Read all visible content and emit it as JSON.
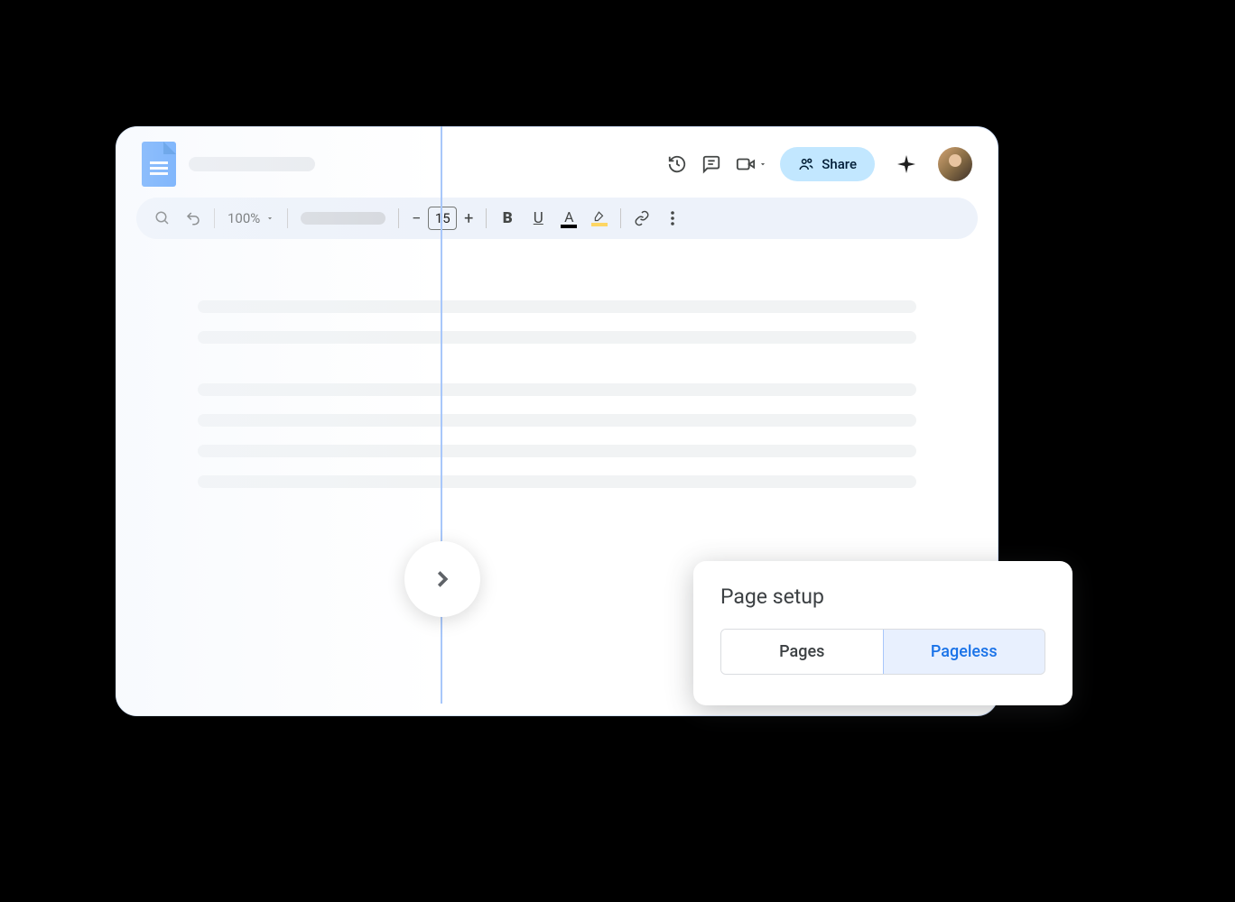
{
  "header": {
    "share_label": "Share"
  },
  "toolbar": {
    "zoom": "100%",
    "font_size": "15"
  },
  "page_setup": {
    "title": "Page setup",
    "pages_label": "Pages",
    "pageless_label": "Pageless"
  }
}
